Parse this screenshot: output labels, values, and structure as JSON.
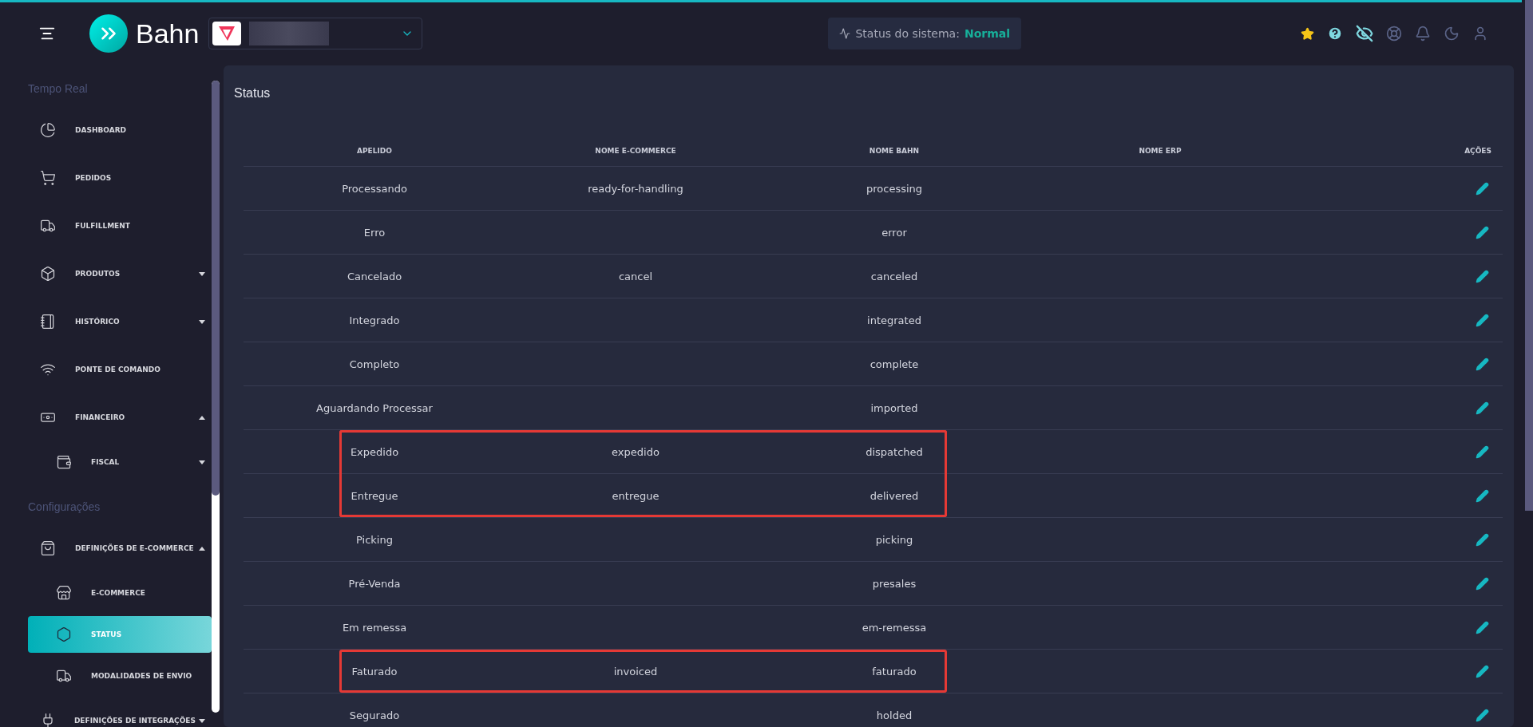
{
  "header": {
    "brand": "Bahn",
    "status_label": "Status do sistema:",
    "status_value": "Normal"
  },
  "sidebar": {
    "sections": [
      {
        "title": "Tempo Real",
        "items": [
          {
            "label": "DASHBOARD",
            "selected": false
          },
          {
            "label": "PEDIDOS",
            "selected": false
          },
          {
            "label": "FULFILLMENT",
            "selected": false
          },
          {
            "label": "PRODUTOS",
            "expanded": false,
            "selected": false
          },
          {
            "label": "HISTÓRICO",
            "expanded": false,
            "selected": false
          },
          {
            "label": "PONTE DE COMANDO",
            "selected": false
          },
          {
            "label": "FINANCEIRO",
            "expanded": true,
            "selected": false,
            "children": [
              {
                "label": "FISCAL",
                "expanded": false,
                "selected": false
              }
            ]
          }
        ]
      },
      {
        "title": "Configurações",
        "items": [
          {
            "label": "DEFINIÇÕES DE E-COMMERCE",
            "expanded": true,
            "selected": false,
            "children": [
              {
                "label": "E-COMMERCE",
                "selected": false
              },
              {
                "label": "STATUS",
                "selected": true
              },
              {
                "label": "MODALIDADES DE ENVIO",
                "selected": false
              }
            ]
          },
          {
            "label": "DEFINIÇÕES DE INTEGRAÇÕES",
            "expanded": false,
            "selected": false
          }
        ]
      }
    ]
  },
  "page": {
    "title": "Status"
  },
  "table": {
    "columns": [
      "APELIDO",
      "NOME E-COMMERCE",
      "NOME BAHN",
      "NOME ERP",
      "AÇÕES"
    ],
    "rows": [
      {
        "apelido": "Processando",
        "ecommerce": "ready-for-handling",
        "bahn": "processing",
        "highlighted": false
      },
      {
        "apelido": "Erro",
        "bahn": "error",
        "highlighted": false
      },
      {
        "apelido": "Cancelado",
        "ecommerce": "cancel",
        "bahn": "canceled",
        "highlighted": false
      },
      {
        "apelido": "Integrado",
        "bahn": "integrated",
        "highlighted": false
      },
      {
        "apelido": "Completo",
        "bahn": "complete",
        "highlighted": false
      },
      {
        "apelido": "Aguardando Processar",
        "bahn": "imported",
        "highlighted": false
      },
      {
        "apelido": "Expedido",
        "ecommerce": "expedido",
        "bahn": "dispatched",
        "highlighted": true
      },
      {
        "apelido": "Entregue",
        "ecommerce": "entregue",
        "bahn": "delivered",
        "highlighted": true
      },
      {
        "apelido": "Picking",
        "bahn": "picking",
        "highlighted": false
      },
      {
        "apelido": "Pré-Venda",
        "bahn": "presales",
        "highlighted": false
      },
      {
        "apelido": "Em remessa",
        "bahn": "em-remessa",
        "highlighted": false
      },
      {
        "apelido": "Faturado",
        "ecommerce": "invoiced",
        "bahn": "faturado",
        "highlighted": true
      },
      {
        "apelido": "Segurado",
        "bahn": "holded",
        "highlighted": false
      }
    ]
  }
}
